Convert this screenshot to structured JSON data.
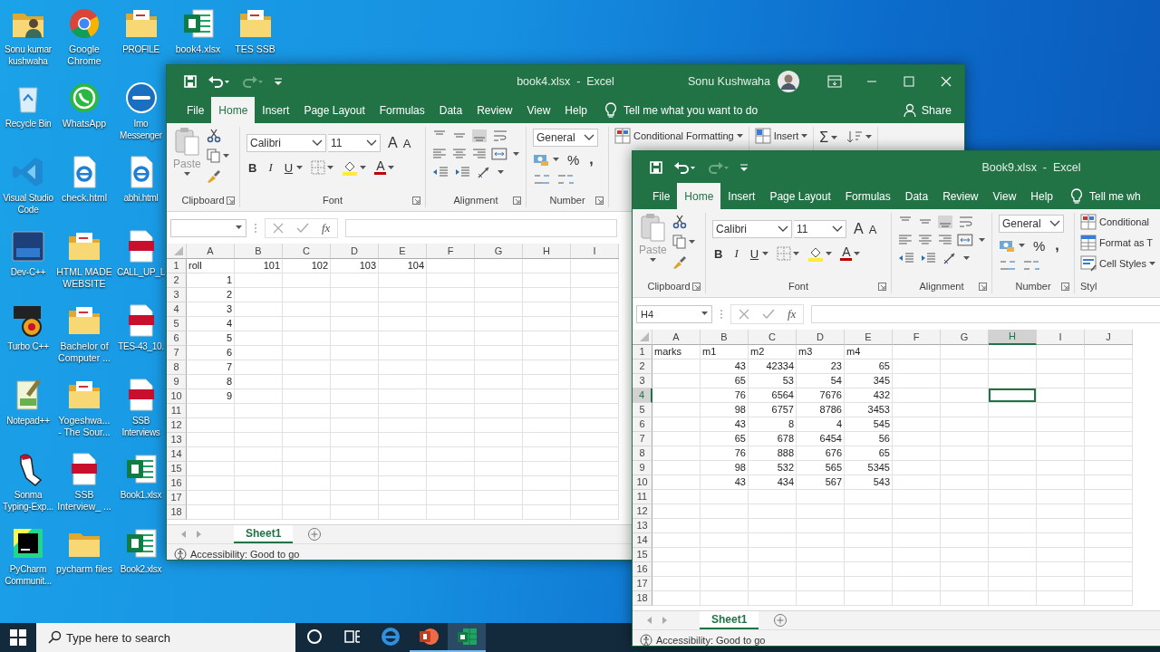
{
  "desktop_columns": [
    [
      {
        "label": "Sonu kumar kushwaha",
        "kind": "user-folder"
      },
      {
        "label": "Recycle Bin",
        "kind": "recycle"
      },
      {
        "label": "Visual Studio Code",
        "kind": "vscode"
      },
      {
        "label": "Dev-C++",
        "kind": "dev"
      },
      {
        "label": "Turbo C++",
        "kind": "turbo"
      },
      {
        "label": "Notepad++",
        "kind": "notepad"
      },
      {
        "label": "Sonma Typing-Exp...",
        "kind": "typing"
      },
      {
        "label": "PyCharm Communit...",
        "kind": "pycharm"
      }
    ],
    [
      {
        "label": "Google Chrome",
        "kind": "chrome"
      },
      {
        "label": "WhatsApp",
        "kind": "whatsapp"
      },
      {
        "label": "check.html",
        "kind": "edge-file"
      },
      {
        "label": "HTML MADE WEBSITE",
        "kind": "doc-folder"
      },
      {
        "label": "Bachelor of Computer ...",
        "kind": "doc-folder"
      },
      {
        "label": "Yogeshwa... - The Sour...",
        "kind": "doc-folder"
      },
      {
        "label": "SSB Interview_ ...",
        "kind": "pdf"
      },
      {
        "label": "pycharm files",
        "kind": "folder"
      }
    ],
    [
      {
        "label": "PROFILE",
        "kind": "doc-folder"
      },
      {
        "label": "Imo Messenger",
        "kind": "imo"
      },
      {
        "label": "abhi.html",
        "kind": "edge-file"
      },
      {
        "label": "CALL_UP_L",
        "kind": "pdf"
      },
      {
        "label": "TES-43_10.",
        "kind": "pdf"
      },
      {
        "label": "SSB Interviews",
        "kind": "pdf"
      },
      {
        "label": "Book1.xlsx",
        "kind": "excel"
      },
      {
        "label": "Book2.xlsx",
        "kind": "excel"
      }
    ],
    [
      {
        "label": "book4.xlsx",
        "kind": "excel"
      }
    ],
    [
      {
        "label": "TES SSB",
        "kind": "doc-folder"
      }
    ]
  ],
  "windows": [
    {
      "title": "book4.xlsx  -  Excel",
      "user": "Sonu Kushwaha",
      "quick_access": [
        {
          "kind": "save",
          "disabled": false
        },
        {
          "kind": "undo",
          "disabled": false
        },
        {
          "kind": "redo",
          "disabled": true
        },
        {
          "kind": "customize",
          "disabled": false
        }
      ],
      "controls": [
        {
          "kind": "ribbon-options"
        },
        {
          "kind": "minimize"
        },
        {
          "kind": "maximize"
        },
        {
          "kind": "close"
        }
      ],
      "tabs": [
        {
          "label": "File",
          "selected": false
        },
        {
          "label": "Home",
          "selected": true
        },
        {
          "label": "Insert",
          "selected": false
        },
        {
          "label": "Page Layout",
          "selected": false
        },
        {
          "label": "Formulas",
          "selected": false
        },
        {
          "label": "Data",
          "selected": false
        },
        {
          "label": "Review",
          "selected": false
        },
        {
          "label": "View",
          "selected": false
        },
        {
          "label": "Help",
          "selected": false
        }
      ],
      "tell_me": "Tell me what you want to do",
      "share": "Share",
      "ribbon": {
        "paste": "Paste",
        "font_name": "Calibri",
        "font_size": "11",
        "grow": "A",
        "shrink": "A",
        "bold": "B",
        "italic": "I",
        "underline": "U",
        "font_color": "A",
        "number_format": "General",
        "percent": "%",
        "comma": ",",
        "groups": [
          "Clipboard",
          "Font",
          "Alignment",
          "Number"
        ],
        "more": [
          {
            "kind": "stack",
            "items": [
              {
                "kind": "conditional",
                "label": "Conditional Formatting",
                "dropdown": true
              }
            ]
          },
          {
            "kind": "stack",
            "items": [
              {
                "kind": "insert",
                "label": "Insert",
                "dropdown": true
              }
            ]
          },
          {
            "kind": "row",
            "items": [
              {
                "kind": "sum",
                "label": "Σ",
                "dropdown": true
              },
              {
                "kind": "sort",
                "dropdown": true
              }
            ]
          }
        ]
      },
      "fx": "fx",
      "columns": [
        {
          "label": "A",
          "selected": false
        },
        {
          "label": "B",
          "selected": false
        },
        {
          "label": "C",
          "selected": false
        },
        {
          "label": "D",
          "selected": false
        },
        {
          "label": "E",
          "selected": false
        },
        {
          "label": "F",
          "selected": false
        },
        {
          "label": "G",
          "selected": false
        },
        {
          "label": "H",
          "selected": false
        },
        {
          "label": "I",
          "selected": false
        }
      ],
      "rows": [
        {
          "header": "1",
          "selected": false,
          "cells": [
            {
              "text": "roll",
              "kind": "text"
            },
            {
              "text": "101",
              "kind": "number"
            },
            {
              "text": "102",
              "kind": "number"
            },
            {
              "text": "103",
              "kind": "number"
            },
            {
              "text": "104",
              "kind": "number"
            }
          ]
        },
        {
          "header": "2",
          "selected": false,
          "cells": [
            {
              "text": "1",
              "kind": "number"
            }
          ]
        },
        {
          "header": "3",
          "selected": false,
          "cells": [
            {
              "text": "2",
              "kind": "number"
            }
          ]
        },
        {
          "header": "4",
          "selected": false,
          "cells": [
            {
              "text": "3",
              "kind": "number"
            }
          ]
        },
        {
          "header": "5",
          "selected": false,
          "cells": [
            {
              "text": "4",
              "kind": "number"
            }
          ]
        },
        {
          "header": "6",
          "selected": false,
          "cells": [
            {
              "text": "5",
              "kind": "number"
            }
          ]
        },
        {
          "header": "7",
          "selected": false,
          "cells": [
            {
              "text": "6",
              "kind": "number"
            }
          ]
        },
        {
          "header": "8",
          "selected": false,
          "cells": [
            {
              "text": "7",
              "kind": "number"
            }
          ]
        },
        {
          "header": "9",
          "selected": false,
          "cells": [
            {
              "text": "8",
              "kind": "number"
            }
          ]
        },
        {
          "header": "10",
          "selected": false,
          "cells": [
            {
              "text": "9",
              "kind": "number"
            }
          ]
        },
        {
          "header": "11",
          "selected": false
        },
        {
          "header": "12",
          "selected": false
        },
        {
          "header": "13",
          "selected": false
        },
        {
          "header": "14",
          "selected": false
        },
        {
          "header": "15",
          "selected": false
        },
        {
          "header": "16",
          "selected": false
        },
        {
          "header": "17",
          "selected": false
        },
        {
          "header": "18",
          "selected": false
        }
      ],
      "sheets": [
        {
          "label": "Sheet1",
          "selected": true
        }
      ],
      "status": "Accessibility: Good to go"
    },
    {
      "title": "Book9.xlsx  -  Excel",
      "quick_access": [
        {
          "kind": "save",
          "disabled": false
        },
        {
          "kind": "undo",
          "disabled": false
        },
        {
          "kind": "redo",
          "disabled": true
        },
        {
          "kind": "customize",
          "disabled": false
        }
      ],
      "tabs": [
        {
          "label": "File",
          "selected": false
        },
        {
          "label": "Home",
          "selected": true
        },
        {
          "label": "Insert",
          "selected": false
        },
        {
          "label": "Page Layout",
          "selected": false
        },
        {
          "label": "Formulas",
          "selected": false
        },
        {
          "label": "Data",
          "selected": false
        },
        {
          "label": "Review",
          "selected": false
        },
        {
          "label": "View",
          "selected": false
        },
        {
          "label": "Help",
          "selected": false
        }
      ],
      "tell_me": "Tell me wh",
      "ribbon": {
        "paste": "Paste",
        "font_name": "Calibri",
        "font_size": "11",
        "grow": "A",
        "shrink": "A",
        "bold": "B",
        "italic": "I",
        "underline": "U",
        "font_color": "A",
        "number_format": "General",
        "percent": "%",
        "comma": ",",
        "groups": [
          "Clipboard",
          "Font",
          "Alignment",
          "Number"
        ],
        "more": [
          {
            "kind": "stack",
            "label": "Styl",
            "items": [
              {
                "kind": "conditional",
                "label": "Conditional",
                "dropdown": false
              },
              {
                "kind": "format-table",
                "label": "Format as T",
                "dropdown": false
              },
              {
                "kind": "cell-styles",
                "label": "Cell Styles",
                "dropdown": true
              }
            ]
          }
        ]
      },
      "name_box": "H4",
      "fx": "fx",
      "columns": [
        {
          "label": "A",
          "selected": false
        },
        {
          "label": "B",
          "selected": false
        },
        {
          "label": "C",
          "selected": false
        },
        {
          "label": "D",
          "selected": false
        },
        {
          "label": "E",
          "selected": false
        },
        {
          "label": "F",
          "selected": false
        },
        {
          "label": "G",
          "selected": false
        },
        {
          "label": "H",
          "selected": true
        },
        {
          "label": "I",
          "selected": false
        },
        {
          "label": "J",
          "selected": false
        }
      ],
      "rows": [
        {
          "header": "1",
          "selected": false,
          "cells": [
            {
              "text": "marks",
              "kind": "text"
            },
            {
              "text": "m1",
              "kind": "text"
            },
            {
              "text": "m2",
              "kind": "text"
            },
            {
              "text": "m3",
              "kind": "text"
            },
            {
              "text": "m4",
              "kind": "text"
            }
          ]
        },
        {
          "header": "2",
          "selected": false,
          "cells": [
            null,
            {
              "text": "43",
              "kind": "number"
            },
            {
              "text": "42334",
              "kind": "number"
            },
            {
              "text": "23",
              "kind": "number"
            },
            {
              "text": "65",
              "kind": "number"
            }
          ]
        },
        {
          "header": "3",
          "selected": false,
          "cells": [
            null,
            {
              "text": "65",
              "kind": "number"
            },
            {
              "text": "53",
              "kind": "number"
            },
            {
              "text": "54",
              "kind": "number"
            },
            {
              "text": "345",
              "kind": "number"
            }
          ]
        },
        {
          "header": "4",
          "selected": true,
          "cells": [
            null,
            {
              "text": "76",
              "kind": "number"
            },
            {
              "text": "6564",
              "kind": "number"
            },
            {
              "text": "7676",
              "kind": "number"
            },
            {
              "text": "432",
              "kind": "number"
            }
          ]
        },
        {
          "header": "5",
          "selected": false,
          "cells": [
            null,
            {
              "text": "98",
              "kind": "number"
            },
            {
              "text": "6757",
              "kind": "number"
            },
            {
              "text": "8786",
              "kind": "number"
            },
            {
              "text": "3453",
              "kind": "number"
            }
          ]
        },
        {
          "header": "6",
          "selected": false,
          "cells": [
            null,
            {
              "text": "43",
              "kind": "number"
            },
            {
              "text": "8",
              "kind": "number"
            },
            {
              "text": "4",
              "kind": "number"
            },
            {
              "text": "545",
              "kind": "number"
            }
          ]
        },
        {
          "header": "7",
          "selected": false,
          "cells": [
            null,
            {
              "text": "65",
              "kind": "number"
            },
            {
              "text": "678",
              "kind": "number"
            },
            {
              "text": "6454",
              "kind": "number"
            },
            {
              "text": "56",
              "kind": "number"
            }
          ]
        },
        {
          "header": "8",
          "selected": false,
          "cells": [
            null,
            {
              "text": "76",
              "kind": "number"
            },
            {
              "text": "888",
              "kind": "number"
            },
            {
              "text": "676",
              "kind": "number"
            },
            {
              "text": "65",
              "kind": "number"
            }
          ]
        },
        {
          "header": "9",
          "selected": false,
          "cells": [
            null,
            {
              "text": "98",
              "kind": "number"
            },
            {
              "text": "532",
              "kind": "number"
            },
            {
              "text": "565",
              "kind": "number"
            },
            {
              "text": "5345",
              "kind": "number"
            }
          ]
        },
        {
          "header": "10",
          "selected": false,
          "cells": [
            null,
            {
              "text": "43",
              "kind": "number"
            },
            {
              "text": "434",
              "kind": "number"
            },
            {
              "text": "567",
              "kind": "number"
            },
            {
              "text": "543",
              "kind": "number"
            }
          ]
        },
        {
          "header": "11",
          "selected": false
        },
        {
          "header": "12",
          "selected": false
        },
        {
          "header": "13",
          "selected": false
        },
        {
          "header": "14",
          "selected": false
        },
        {
          "header": "15",
          "selected": false
        },
        {
          "header": "16",
          "selected": false
        },
        {
          "header": "17",
          "selected": false
        },
        {
          "header": "18",
          "selected": false
        }
      ],
      "sheets": [
        {
          "label": "Sheet1",
          "selected": true
        }
      ],
      "status": "Accessibility: Good to go"
    }
  ],
  "taskbar": {
    "search": {
      "placeholder": "Type here to search"
    },
    "apps": [
      {
        "kind": "cortana",
        "running": false,
        "active": false
      },
      {
        "kind": "task-view",
        "running": false,
        "active": false
      },
      {
        "kind": "edge",
        "running": false,
        "active": false
      },
      {
        "kind": "powerpoint",
        "running": true,
        "active": false
      },
      {
        "kind": "excel",
        "running": true,
        "active": true
      }
    ]
  }
}
